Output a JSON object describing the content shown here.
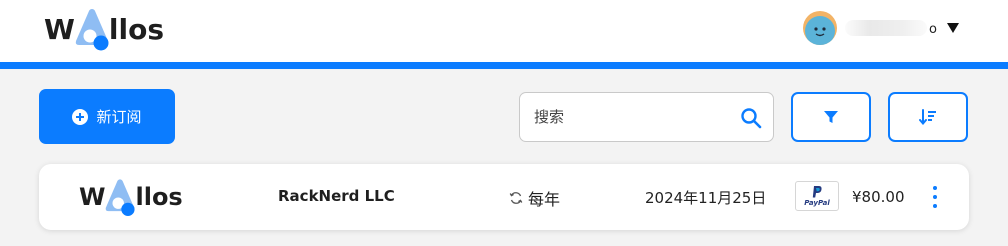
{
  "app": {
    "logo_prefix": "W",
    "logo_suffix": "llos",
    "brand_color": "#0b7cff"
  },
  "header": {
    "username_visible_tail": "o"
  },
  "toolbar": {
    "new_subscription_label": "新订阅",
    "search_placeholder": "搜索"
  },
  "subscriptions": [
    {
      "name": "RackNerd LLC",
      "cycle": "每年",
      "next_payment": "2024年11月25日",
      "payment_method": "PayPal",
      "price": "¥80.00"
    }
  ]
}
